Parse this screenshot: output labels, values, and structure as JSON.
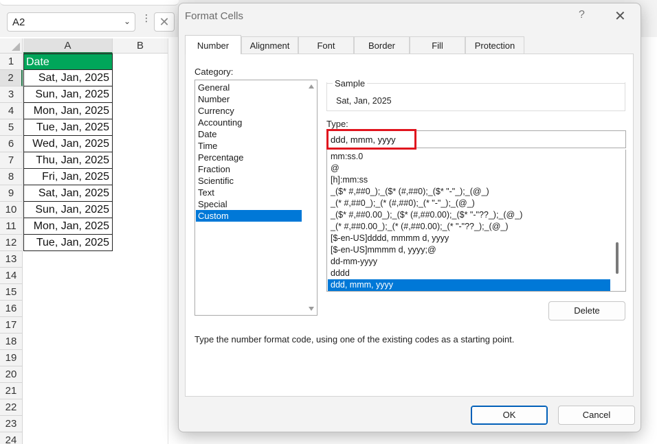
{
  "excel": {
    "namebox": "A2",
    "columns": [
      "A",
      "B"
    ],
    "rows": [
      "1",
      "2",
      "3",
      "4",
      "5",
      "6",
      "7",
      "8",
      "9",
      "10",
      "11",
      "12",
      "13",
      "14",
      "15",
      "16",
      "17",
      "18",
      "19",
      "20",
      "21",
      "22",
      "23",
      "24"
    ],
    "cells": [
      "Date",
      "Sat, Jan, 2025",
      "Sun, Jan, 2025",
      "Mon, Jan, 2025",
      "Tue, Jan, 2025",
      "Wed, Jan, 2025",
      "Thu, Jan, 2025",
      "Fri, Jan, 2025",
      "Sat, Jan, 2025",
      "Sun, Jan, 2025",
      "Mon, Jan, 2025",
      "Tue, Jan, 2025"
    ],
    "header_fill": "#00a65a"
  },
  "dialog": {
    "title": "Format Cells",
    "help": "?",
    "close": "✕",
    "tabs": [
      "Number",
      "Alignment",
      "Font",
      "Border",
      "Fill",
      "Protection"
    ],
    "active_tab": "Number",
    "category_label": "Category:",
    "categories": [
      "General",
      "Number",
      "Currency",
      "Accounting",
      "Date",
      "Time",
      "Percentage",
      "Fraction",
      "Scientific",
      "Text",
      "Special",
      "Custom"
    ],
    "selected_category": "Custom",
    "sample_label": "Sample",
    "sample_value": "Sat, Jan, 2025",
    "type_label": "Type:",
    "type_value": "ddd, mmm, yyyy",
    "formats": [
      "mm:ss.0",
      "@",
      "[h]:mm:ss",
      "_($* #,##0_);_($* (#,##0);_($* \"-\"_);_(@_)",
      "_(* #,##0_);_(* (#,##0);_(* \"-\"_);_(@_)",
      "_($* #,##0.00_);_($* (#,##0.00);_($* \"-\"??_);_(@_)",
      "_(* #,##0.00_);_(* (#,##0.00);_(* \"-\"??_);_(@_)",
      "[$-en-US]dddd, mmmm d, yyyy",
      "[$-en-US]mmmm d, yyyy;@",
      "dd-mm-yyyy",
      "dddd",
      "ddd, mmm, yyyy"
    ],
    "selected_format": "ddd, mmm, yyyy",
    "delete_label": "Delete",
    "hint": "Type the number format code, using one of the existing codes as a starting point.",
    "ok_label": "OK",
    "cancel_label": "Cancel",
    "highlight_color": "#e0141e",
    "selection_color": "#0078d7"
  }
}
